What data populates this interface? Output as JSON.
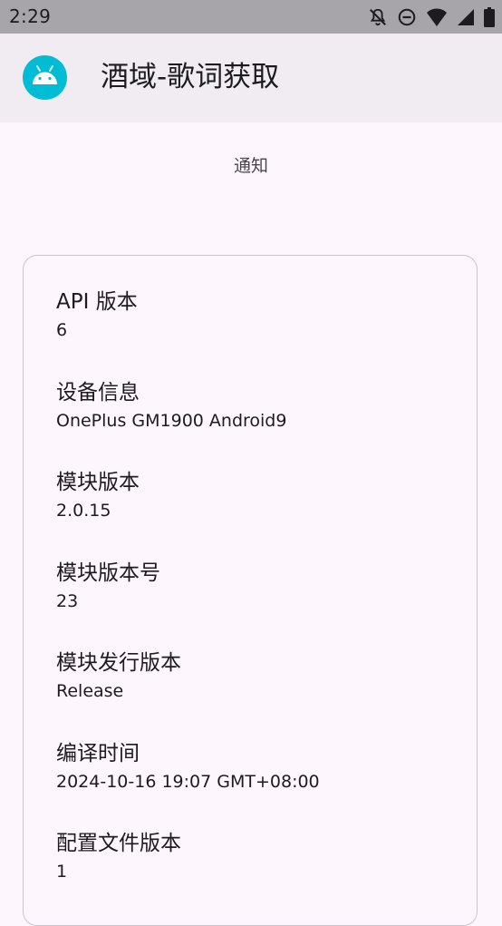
{
  "status_bar": {
    "time": "2:29",
    "icons": [
      "notifications-off-icon",
      "do-not-disturb-icon",
      "wifi-icon",
      "signal-icon",
      "battery-icon"
    ]
  },
  "app_bar": {
    "logo_icon": "android-icon",
    "logo_color": "#00bcd4",
    "title": "酒域-歌词获取"
  },
  "notice_button": {
    "label": "通知"
  },
  "info": {
    "items": [
      {
        "label": "API 版本",
        "value": "6"
      },
      {
        "label": "设备信息",
        "value": "OnePlus GM1900 Android9"
      },
      {
        "label": "模块版本",
        "value": "2.0.15"
      },
      {
        "label": "模块版本号",
        "value": "23"
      },
      {
        "label": "模块发行版本",
        "value": "Release"
      },
      {
        "label": "编译时间",
        "value": "2024-10-16 19:07 GMT+08:00"
      },
      {
        "label": "配置文件版本",
        "value": "1"
      }
    ]
  }
}
